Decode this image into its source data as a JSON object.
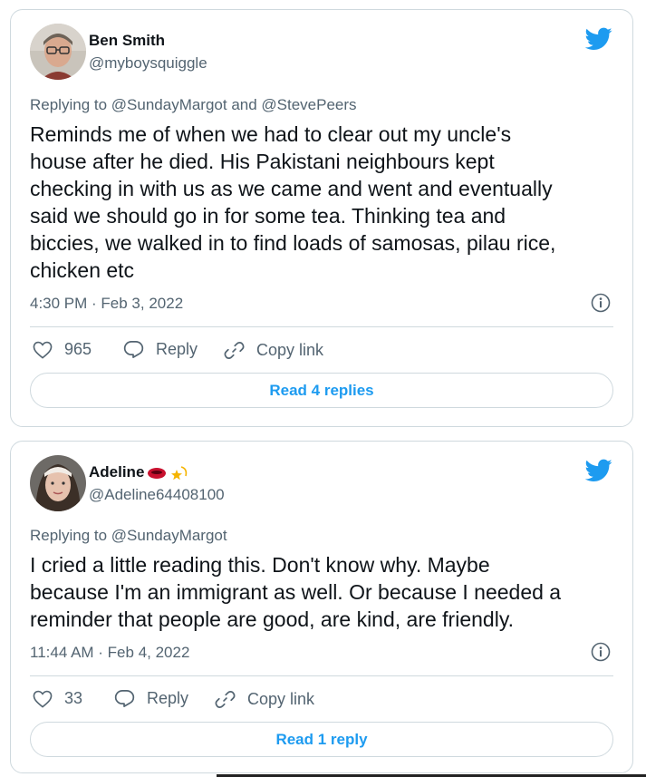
{
  "tweets": [
    {
      "name": "Ben Smith",
      "handle": "@myboysquiggle",
      "replying": "Replying to @SundayMargot and @StevePeers",
      "body_lines": [
        "Reminds me of when we had to clear out my uncle's",
        "house after he died. His Pakistani neighbours kept",
        "checking in with us as we came and went and eventually",
        "said we should go in for some tea. Thinking tea and",
        "biccies, we walked in to find loads of samosas, pilau rice,",
        "chicken etc"
      ],
      "timestamp": "4:30 PM · Feb 3, 2022",
      "likes": "965",
      "reply_label": "Reply",
      "copy_label": "Copy link",
      "read_replies": "Read 4 replies"
    },
    {
      "name": "Adeline",
      "handle": "@Adeline64408100",
      "replying": "Replying to @SundayMargot",
      "body_lines": [
        "I cried a little reading this. Don't know why. Maybe",
        "because I'm an immigrant as well. Or because I needed a",
        "reminder that people are good, are kind, are friendly."
      ],
      "timestamp": "11:44 AM · Feb 4, 2022",
      "likes": "33",
      "reply_label": "Reply",
      "copy_label": "Copy link",
      "read_replies": "Read 1 reply"
    }
  ],
  "icons": {
    "brand": "twitter-bird-icon",
    "info": "info-icon",
    "like": "heart-icon",
    "reply": "speech-bubble-icon",
    "copy": "link-icon"
  },
  "colors": {
    "brand_blue": "#1d9bf0",
    "secondary_text": "#536471",
    "border": "#cfd9de"
  }
}
